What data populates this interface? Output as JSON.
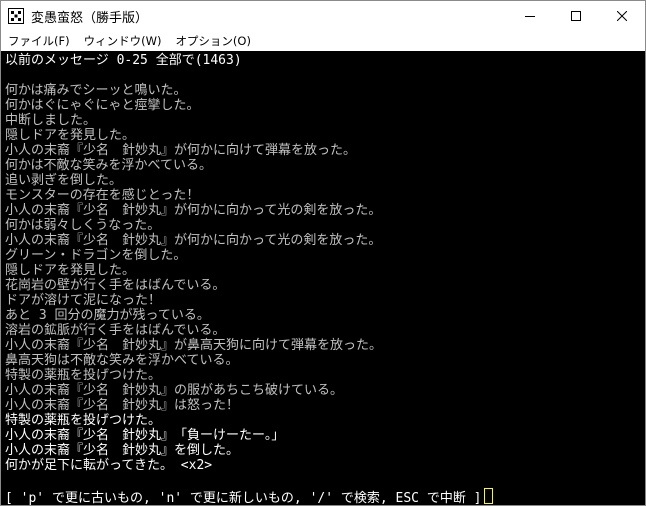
{
  "window": {
    "title": "変愚蛮怒（勝手版）"
  },
  "menu": {
    "items": [
      "ファイル(F)",
      "ウィンドウ(W)",
      "オプション(O)"
    ]
  },
  "console": {
    "header": "以前のメッセージ 0-25 全部で(1463)",
    "messages_old": [
      "何かは痛みでシーッと鳴いた。",
      "何かはぐにゃぐにゃと痙攣した。",
      "中断しました。",
      "隠しドアを発見した。",
      "小人の末裔『少名　針妙丸』が何かに向けて弾幕を放った。",
      "何かは不敵な笑みを浮かべている。",
      "追い剥ぎを倒した。",
      "モンスターの存在を感じとった！",
      "小人の末裔『少名　針妙丸』が何かに向かって光の剣を放った。",
      "何かは弱々しくうなった。",
      "小人の末裔『少名　針妙丸』が何かに向かって光の剣を放った。",
      "グリーン・ドラゴンを倒した。",
      "隠しドアを発見した。",
      "花崗岩の壁が行く手をはばんでいる。",
      "ドアが溶けて泥になった！",
      "あと 3 回分の魔力が残っている。",
      "溶岩の鉱脈が行く手をはばんでいる。",
      "小人の末裔『少名　針妙丸』が鼻高天狗に向けて弾幕を放った。",
      "鼻高天狗は不敵な笑みを浮かべている。",
      "特製の薬瓶を投げつけた。",
      "小人の末裔『少名　針妙丸』の服があちこち破けている。",
      "小人の末裔『少名　針妙丸』は怒った！"
    ],
    "messages_new": [
      "特製の薬瓶を投げつけた。",
      "小人の末裔『少名　針妙丸』　「負ーけーたー。」",
      "小人の末裔『少名　針妙丸』を倒した。",
      "何かが足下に転がってきた。 <x2>"
    ],
    "footer": "[ 'p' で更に古いもの, 'n' で更に新しいもの, '/' で検索, ESC で中断 ]"
  },
  "colors": {
    "console_bg": "#000000",
    "text_old": "#c0c0c0",
    "text_new": "#ffffff",
    "cursor": "#ffff00"
  }
}
